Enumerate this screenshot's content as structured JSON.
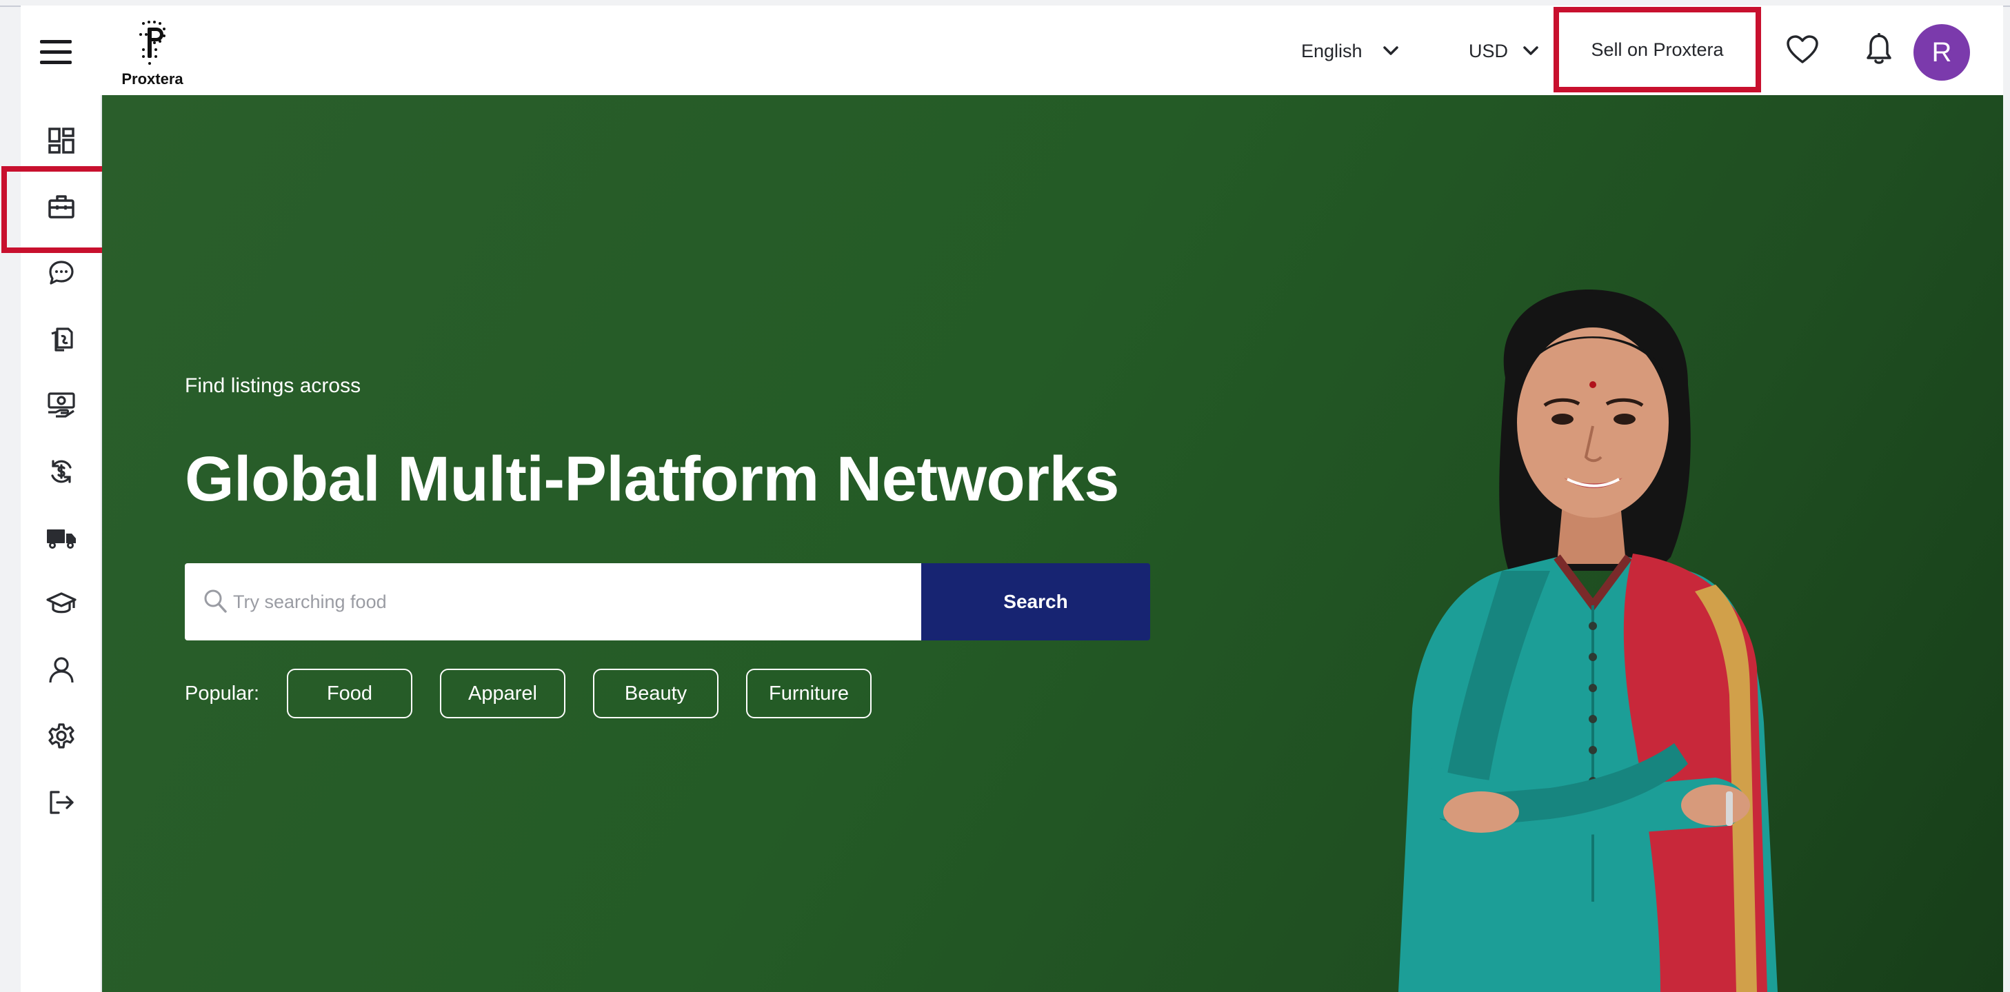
{
  "header": {
    "logo_text": "Proxtera",
    "language": "English",
    "currency": "USD",
    "sell_label": "Sell on Proxtera",
    "avatar_initial": "R"
  },
  "sidebar": {
    "items": [
      {
        "icon": "dashboard-icon"
      },
      {
        "icon": "briefcase-icon",
        "highlighted": true
      },
      {
        "icon": "chat-icon"
      },
      {
        "icon": "documents-icon"
      },
      {
        "icon": "money-hand-icon"
      },
      {
        "icon": "currency-exchange-icon"
      },
      {
        "icon": "truck-icon"
      },
      {
        "icon": "graduation-cap-icon"
      },
      {
        "icon": "user-icon"
      },
      {
        "icon": "settings-icon"
      },
      {
        "icon": "logout-icon"
      }
    ]
  },
  "hero": {
    "eyebrow": "Find listings across",
    "headline": "Global Multi-Platform Networks",
    "search_placeholder": "Try searching food",
    "search_button": "Search",
    "popular_label": "Popular:",
    "popular_chips": [
      "Food",
      "Apparel",
      "Beauty",
      "Furniture"
    ]
  },
  "colors": {
    "hero_green": "#245b26",
    "search_button": "#172472",
    "avatar": "#7b3aac",
    "highlight_red": "#c8102e"
  }
}
